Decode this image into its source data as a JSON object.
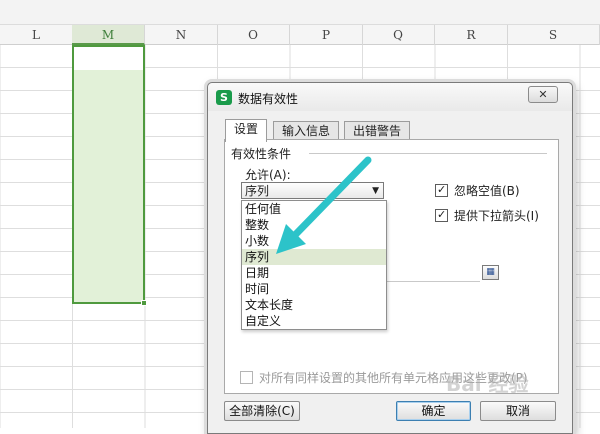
{
  "spreadsheet": {
    "columns": [
      "L",
      "M",
      "N",
      "O",
      "P",
      "Q",
      "R",
      "S"
    ],
    "active_column": "M"
  },
  "dialog": {
    "app_icon": "S",
    "title": "数据有效性",
    "close_label": "✕",
    "tabs": [
      "设置",
      "输入信息",
      "出错警告"
    ],
    "active_tab": "设置",
    "group_title": "有效性条件",
    "allow_label": "允许(A):",
    "allow_value": "序列",
    "allow_options": [
      "任何值",
      "整数",
      "小数",
      "序列",
      "日期",
      "时间",
      "文本长度",
      "自定义"
    ],
    "highlighted_option": "序列",
    "ignore_blank_label": "忽略空值(B)",
    "ignore_blank_checked": true,
    "dropdown_arrow_label": "提供下拉箭头(I)",
    "dropdown_arrow_checked": true,
    "apply_all_label": "对所有同样设置的其他所有单元格应用这些更改(P)",
    "apply_all_checked": false,
    "clear_all_label": "全部清除(C)",
    "ok_label": "确定",
    "cancel_label": "取消"
  },
  "annotation": {
    "arrow_color": "#2cc3c9"
  },
  "watermark_text": "Bai 经验"
}
